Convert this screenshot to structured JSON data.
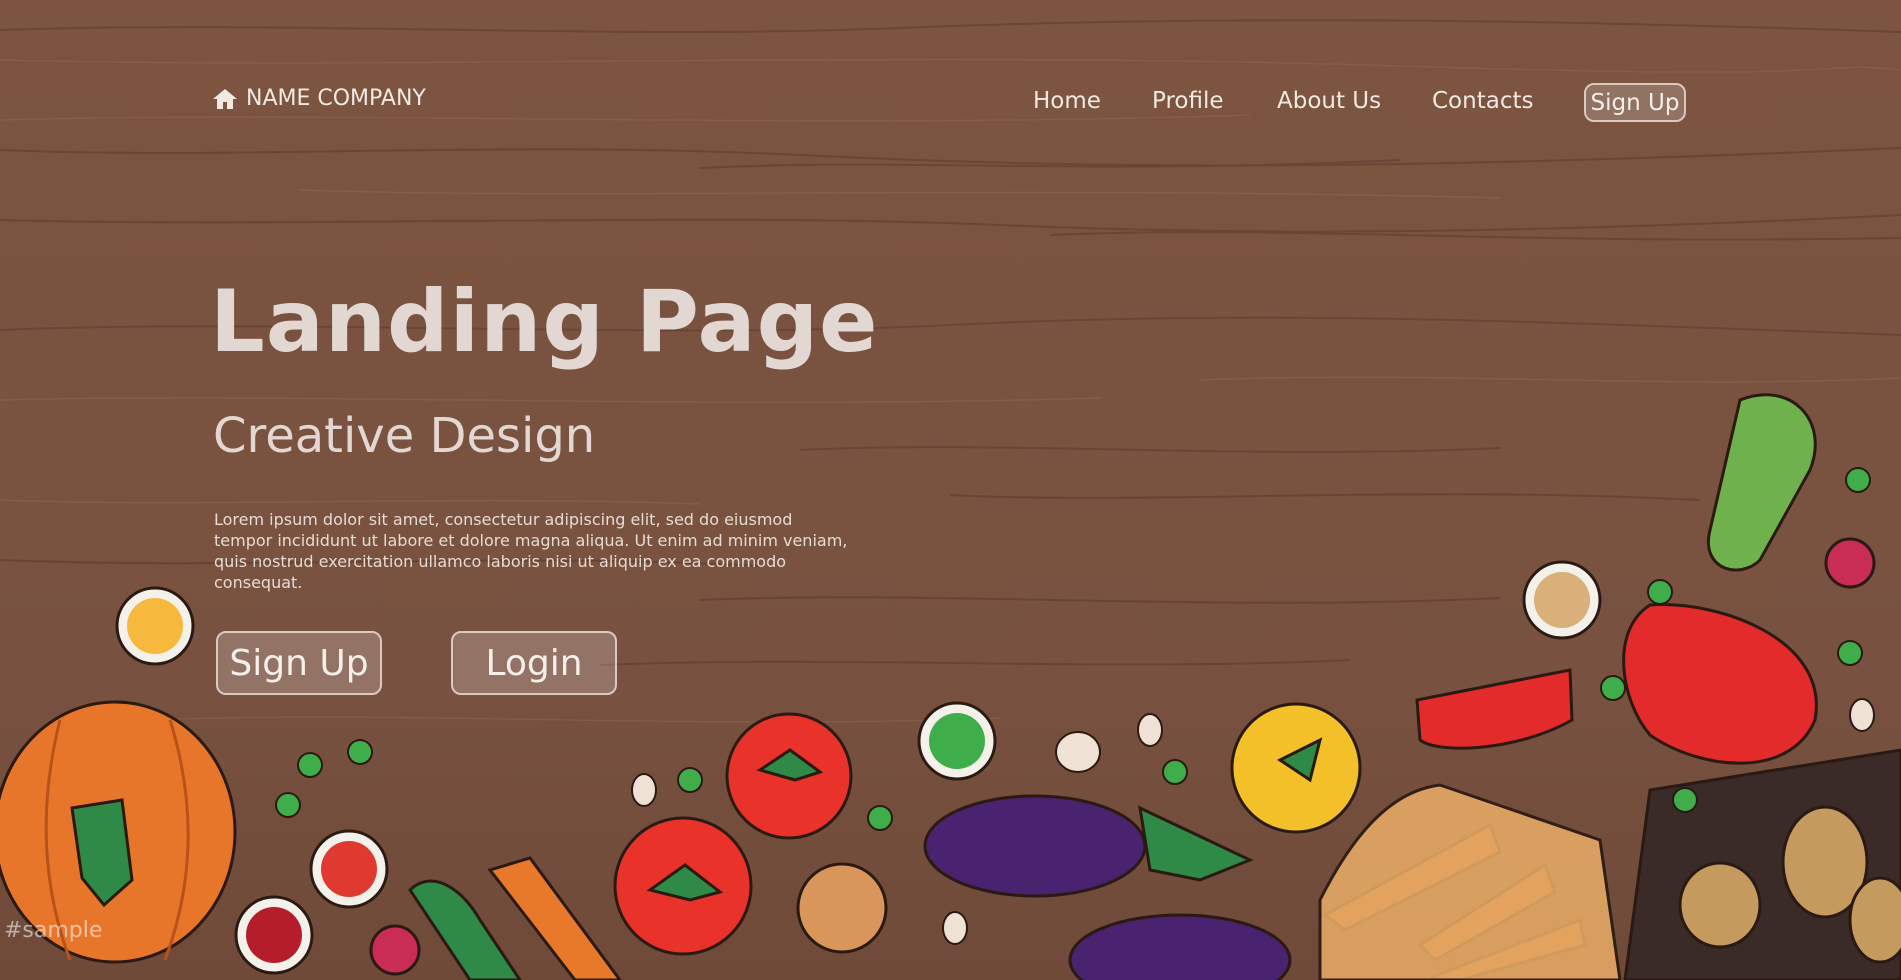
{
  "brand": {
    "icon": "home-icon",
    "name": "NAME COMPANY"
  },
  "nav": {
    "items": [
      {
        "label": "Home"
      },
      {
        "label": "Profile"
      },
      {
        "label": "About Us"
      },
      {
        "label": "Contacts"
      }
    ],
    "signup_label": "Sign Up"
  },
  "hero": {
    "title": "Landing Page",
    "subtitle": "Creative Design",
    "body": "Lorem ipsum dolor sit amet, consectetur adipiscing elit, sed do eiusmod tempor incididunt ut labore et dolore magna aliqua. Ut enim ad minim veniam, quis nostrud exercitation ullamco laboris nisi ut aliquip ex ea commodo consequat.",
    "signup_label": "Sign Up",
    "login_label": "Login"
  },
  "watermark": "#sample",
  "colors": {
    "wood": "#7a5340",
    "text": "#e2d7d2",
    "button_border": "#d9c9c0"
  }
}
